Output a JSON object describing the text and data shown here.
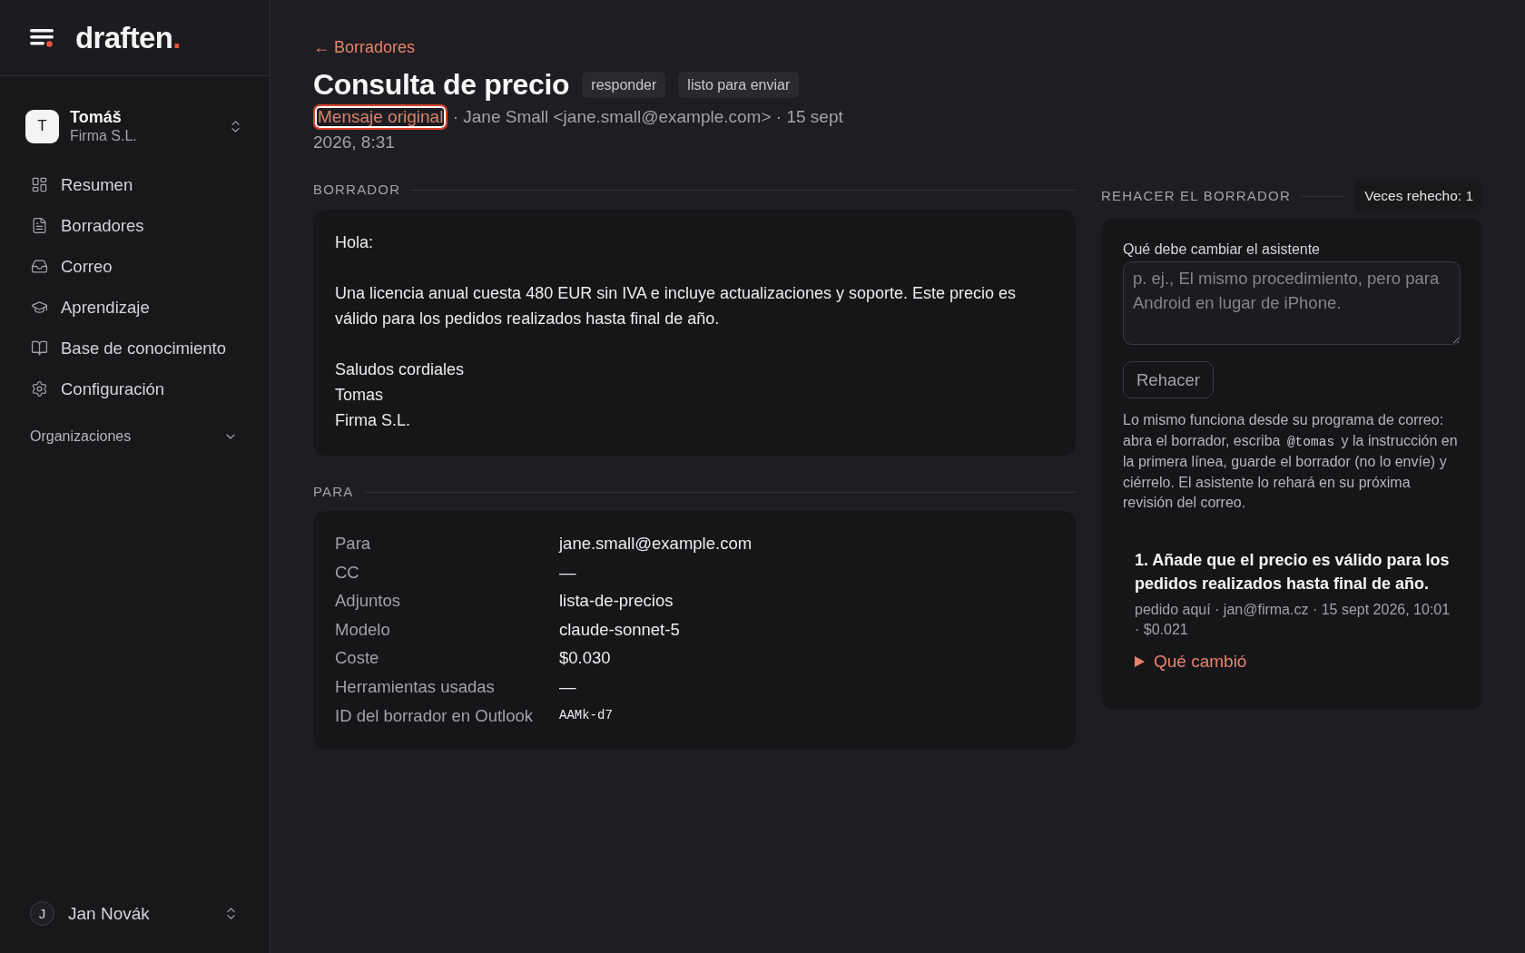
{
  "sidebar": {
    "brand": {
      "name": "draften",
      "dot": "."
    },
    "account": {
      "initial": "T",
      "name": "Tomáš",
      "org": "Firma S.L."
    },
    "nav": [
      {
        "label": "Resumen",
        "selected": false
      },
      {
        "label": "Borradores",
        "selected": false
      },
      {
        "label": "Correo",
        "selected": false
      },
      {
        "label": "Aprendizaje",
        "selected": false
      },
      {
        "label": "Base de conocimiento",
        "selected": false
      },
      {
        "label": "Configuración",
        "selected": false
      }
    ],
    "section": {
      "label": "Organizaciones",
      "expanded": false
    },
    "user": {
      "initial": "J",
      "name": "Jan Novák"
    }
  },
  "header": {
    "back": "← Borradores",
    "title": "Consulta de precio",
    "tags": [
      "responder",
      "listo para enviar"
    ],
    "meta": {
      "link": {
        "label": "Mensaje original",
        "focused": true
      },
      "rest": "· Jane Small <jane.small@example.com> · 15 sept 2026, 8:31"
    }
  },
  "draft": {
    "heading": "BORRADOR",
    "paragraphs": [
      [
        "Hola:"
      ],
      [
        "Una licencia anual cuesta 480 EUR sin IVA e incluye actualizaciones y soporte. Este precio es válido para los pedidos realizados hasta final de año."
      ],
      [
        "Saludos cordiales",
        "Tomas",
        "Firma S.L."
      ]
    ]
  },
  "recipients": {
    "heading": "PARA",
    "rows": [
      {
        "label": "Para",
        "value": "jane.small@example.com",
        "kind": "text"
      },
      {
        "label": "CC",
        "value": "—",
        "kind": "text"
      },
      {
        "label": "Adjuntos",
        "value": "lista-de-precios",
        "kind": "text"
      },
      {
        "label": "Modelo",
        "value": "claude-sonnet-5",
        "kind": "text"
      },
      {
        "label": "Coste",
        "value": "$0.030",
        "kind": "text"
      },
      {
        "label": "Herramientas usadas",
        "value": "—",
        "kind": "text"
      },
      {
        "label": "ID del borrador en Outlook",
        "value": "AAMk-d7",
        "kind": "code"
      }
    ]
  },
  "redo": {
    "heading": "REHACER EL BORRADOR",
    "count": "Veces rehecho: 1",
    "field": {
      "label": "Qué debe cambiar el asistente",
      "placeholder": "p. ej., El mismo procedimiento, pero para Android en lugar de iPhone."
    },
    "button": {
      "label": "Rehacer",
      "disabled": true
    },
    "hint": {
      "before": "Lo mismo funciona desde su programa de correo: abra el borrador, escriba",
      "code": "@tomas",
      "after": "y la instrucción en la primera línea, guarde el borrador (no lo envíe) y ciérrelo. El asistente lo rehará en su próxima revisión del correo."
    },
    "history": [
      {
        "number": "1.",
        "text": "Añade que el precio es válido para los pedidos realizados hasta final de año.",
        "meta": "pedido aquí · jan@firma.cz · 15 sept 2026, 10:01 · $0.021",
        "changes": {
          "label": "Qué cambió",
          "expanded": false
        }
      }
    ]
  }
}
